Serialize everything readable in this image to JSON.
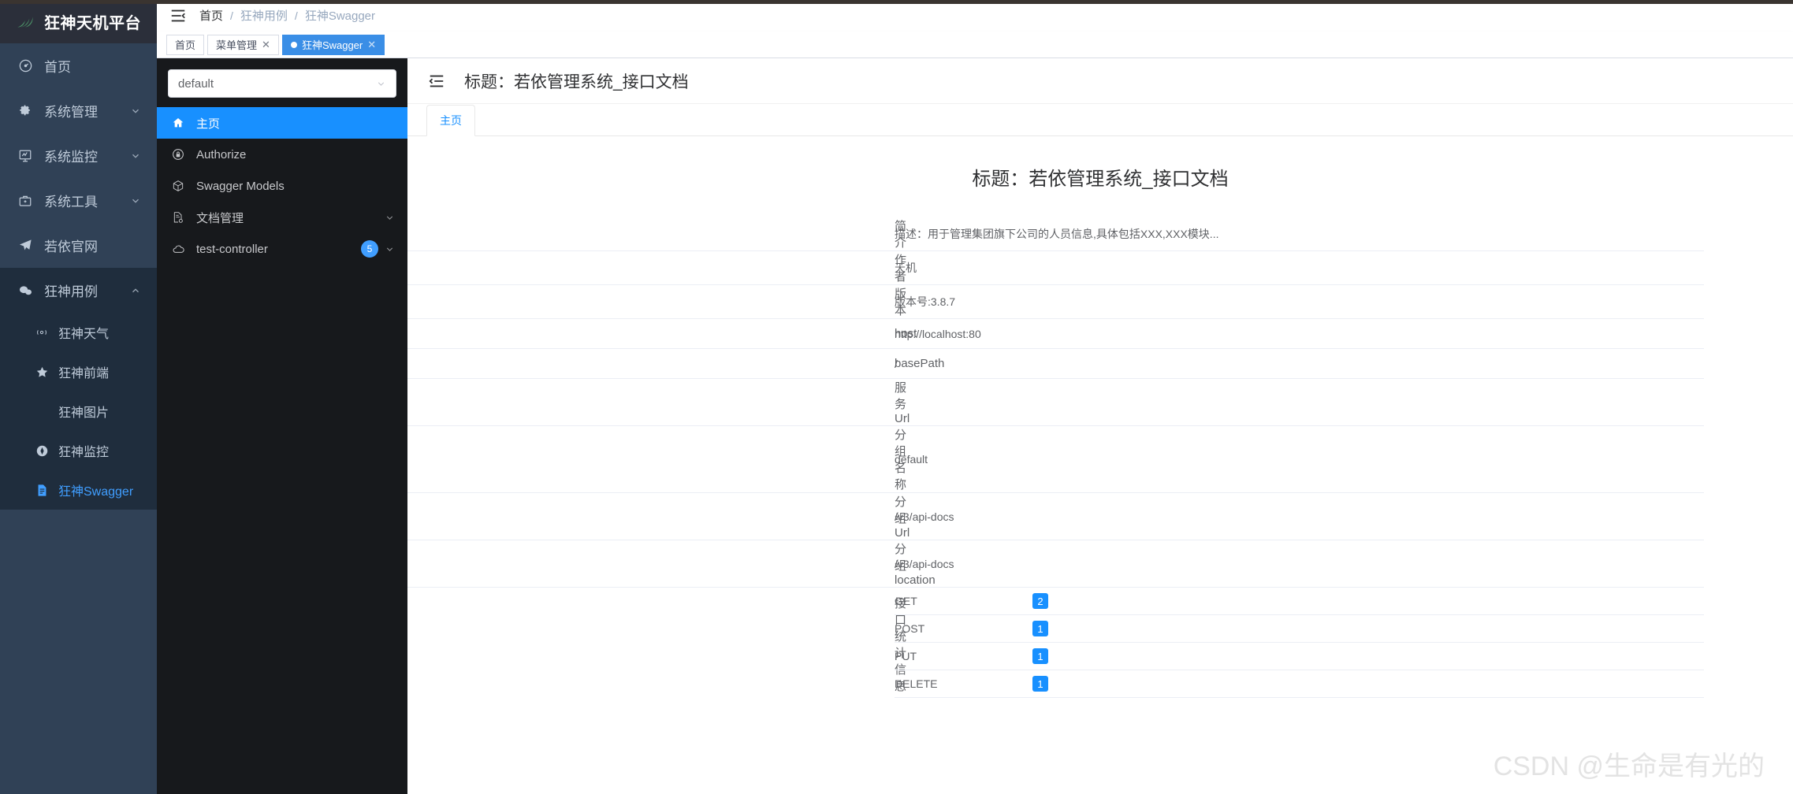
{
  "app": {
    "brand": {
      "title": "狂神天机平台",
      "logo_icon": "leaf-logo-icon"
    }
  },
  "sidebar": {
    "items": [
      {
        "label": "首页",
        "icon": "dashboard-icon",
        "arrow": false,
        "active": false
      },
      {
        "label": "系统管理",
        "icon": "gear-icon",
        "arrow": "down",
        "active": false
      },
      {
        "label": "系统监控",
        "icon": "monitor-icon",
        "arrow": "down",
        "active": false
      },
      {
        "label": "系统工具",
        "icon": "toolbox-icon",
        "arrow": "down",
        "active": false
      },
      {
        "label": "若依官网",
        "icon": "paper-plane-icon",
        "arrow": false,
        "active": false
      },
      {
        "label": "狂神用例",
        "icon": "chat-bubbles-icon",
        "arrow": "up",
        "active": false
      }
    ],
    "submenu": [
      {
        "label": "狂神天气",
        "icon": "signal-icon",
        "active": false
      },
      {
        "label": "狂神前端",
        "icon": "star-icon",
        "active": false
      },
      {
        "label": "狂神图片",
        "icon": "none",
        "active": false
      },
      {
        "label": "狂神监控",
        "icon": "compass-icon",
        "active": false
      },
      {
        "label": "狂神Swagger",
        "icon": "document-icon",
        "active": true
      }
    ]
  },
  "navbar": {
    "hamburger_icon": "hamburger-collapse-icon",
    "breadcrumb": [
      "首页",
      "狂神用例",
      "狂神Swagger"
    ],
    "separator": "/"
  },
  "tabs": [
    {
      "label": "首页",
      "closable": false,
      "active": false
    },
    {
      "label": "菜单管理",
      "closable": true,
      "active": false
    },
    {
      "label": "狂神Swagger",
      "closable": true,
      "active": true
    }
  ],
  "swagger": {
    "group_select": {
      "value": "default",
      "caret_icon": "chevron-down-icon"
    },
    "nav": [
      {
        "label": "主页",
        "icon": "home-icon",
        "active": true,
        "badge": null,
        "arrow": false
      },
      {
        "label": "Authorize",
        "icon": "lock-icon",
        "active": false,
        "badge": null,
        "arrow": false
      },
      {
        "label": "Swagger Models",
        "icon": "cube-icon",
        "active": false,
        "badge": null,
        "arrow": false
      },
      {
        "label": "文档管理",
        "icon": "document-settings-icon",
        "active": false,
        "badge": null,
        "arrow": "down"
      },
      {
        "label": "test-controller",
        "icon": "cloud-icon",
        "active": false,
        "badge": "5",
        "arrow": "down"
      }
    ],
    "header": {
      "collapse_icon": "indent-left-icon",
      "title": "标题：若依管理系统_接口文档"
    },
    "content_tabs": [
      {
        "label": "主页",
        "active": true
      }
    ],
    "doc_title": "标题：若依管理系统_接口文档",
    "info_rows": [
      {
        "key": "简介",
        "value": "描述：用于管理集团旗下公司的人员信息,具体包括XXX,XXX模块..."
      },
      {
        "key": "作者",
        "value": "天机"
      },
      {
        "key": "版本",
        "value": "版本号:3.8.7"
      },
      {
        "key": "host",
        "value": "http://localhost:80"
      },
      {
        "key": "basePath",
        "value": "/"
      },
      {
        "key": "服务Url",
        "value": ""
      },
      {
        "key": "分组名称",
        "value": "default"
      },
      {
        "key": "分组Url",
        "value": "/v3/api-docs"
      },
      {
        "key": "分组location",
        "value": "/v3/api-docs"
      }
    ],
    "stats": {
      "key": "接口统计信息",
      "rows": [
        {
          "method": "GET",
          "count": "2"
        },
        {
          "method": "POST",
          "count": "1"
        },
        {
          "method": "PUT",
          "count": "1"
        },
        {
          "method": "DELETE",
          "count": "1"
        }
      ]
    }
  },
  "watermark": {
    "text": "CSDN @生命是有光的"
  },
  "colors": {
    "sidebar_bg": "#304156",
    "sidebar_submenu_bg": "#1f2d3d",
    "accent": "#409eff",
    "swagger_accent": "#1890ff",
    "swagger_side_bg": "#17191c",
    "tab_active_bg": "#3a8ee6"
  }
}
